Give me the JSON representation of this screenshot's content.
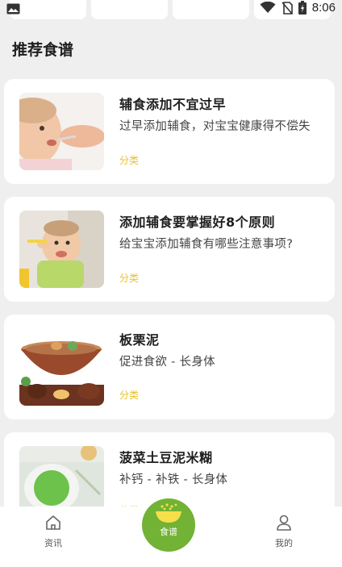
{
  "status_bar": {
    "time": "8:06",
    "icons": [
      "image-icon",
      "wifi-icon",
      "no-sim-icon",
      "battery-icon"
    ]
  },
  "section": {
    "title": "推荐食谱"
  },
  "recipes": [
    {
      "title": "辅食添加不宜过早",
      "desc": "过早添加辅食，对宝宝健康得不偿失",
      "tag": "分类"
    },
    {
      "title": "添加辅食要掌握好8个原则",
      "desc": "给宝宝添加辅食有哪些注意事项?",
      "tag": "分类"
    },
    {
      "title": "板栗泥",
      "desc": "促进食欲 - 长身体",
      "tag": "分类"
    },
    {
      "title": "菠菜土豆泥米糊",
      "desc": "补钙 - 补铁 - 长身体",
      "tag": "分类"
    }
  ],
  "bottom_nav": {
    "items": [
      {
        "label": "资讯",
        "icon": "home-icon"
      },
      {
        "label": "食谱",
        "icon": "bowl-icon"
      },
      {
        "label": "我的",
        "icon": "user-icon"
      }
    ]
  },
  "colors": {
    "accent_green": "#72b235",
    "tag_yellow": "#e7c22c",
    "background": "#efefef"
  }
}
